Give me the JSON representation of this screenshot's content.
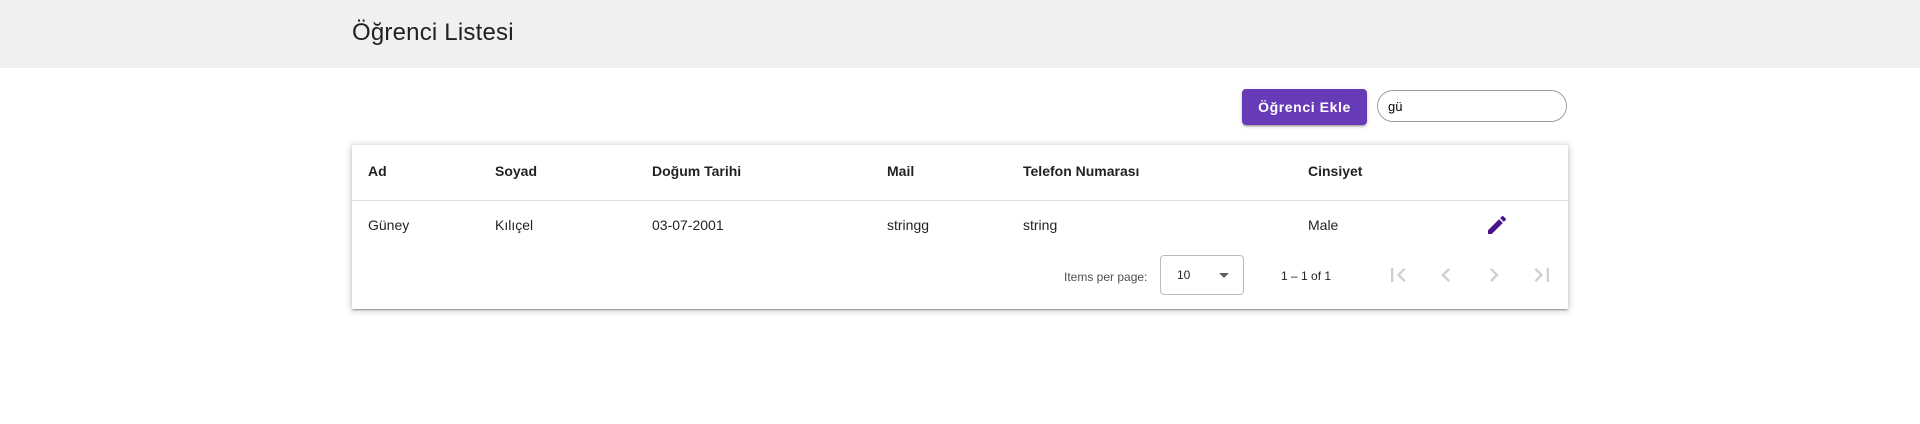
{
  "header": {
    "title": "Öğrenci Listesi"
  },
  "toolbar": {
    "add_label": "Öğrenci Ekle",
    "search_value": "gü"
  },
  "table": {
    "columns": [
      "Ad",
      "Soyad",
      "Doğum Tarihi",
      "Mail",
      "Telefon Numarası",
      "Cinsiyet"
    ],
    "rows": [
      [
        "Güney",
        "Kılıçel",
        "03-07-2001",
        "stringg",
        "string",
        "Male"
      ]
    ]
  },
  "paginator": {
    "items_per_page_label": "Items per page:",
    "items_per_page": "10",
    "range_label": "1 – 1 of 1"
  },
  "colors": {
    "primary": "#673ab7",
    "topbar": "#f0f0f0"
  },
  "icons": {
    "row_action": "edit-pencil-icon",
    "first": "first-page-icon",
    "prev": "chevron-left-icon",
    "next": "chevron-right-icon",
    "last": "last-page-icon"
  }
}
